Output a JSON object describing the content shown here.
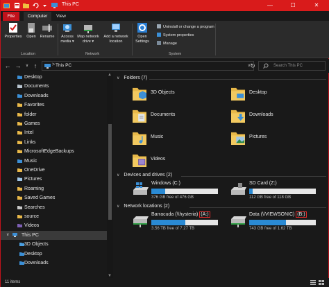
{
  "window": {
    "title": "This PC",
    "minimize": "—",
    "maximize": "☐",
    "close": "✕"
  },
  "tabs": {
    "file": "File",
    "computer": "Computer",
    "view": "View"
  },
  "ribbon": {
    "location": {
      "label": "Location",
      "properties": "Properties",
      "open": "Open",
      "rename": "Rename"
    },
    "network": {
      "label": "Network",
      "access_media_1": "Access",
      "access_media_2": "media ▾",
      "map_drive_1": "Map network",
      "map_drive_2": "drive ▾",
      "add_location_1": "Add a network",
      "add_location_2": "location"
    },
    "system": {
      "label": "System",
      "open_settings_1": "Open",
      "open_settings_2": "Settings",
      "uninstall": "Uninstall or change a program",
      "system_properties": "System properties",
      "manage": "Manage"
    }
  },
  "address": {
    "back": "←",
    "forward": "→",
    "history": "∨",
    "up": "↑",
    "separator": ">",
    "crumb": "This PC",
    "dropdown": "∨",
    "refresh": "↻",
    "search_placeholder": "Search This PC"
  },
  "nav": {
    "items": [
      {
        "label": "Desktop",
        "icon": "folder-blue-icon"
      },
      {
        "label": "Documents",
        "icon": "documents-icon"
      },
      {
        "label": "Downloads",
        "icon": "downloads-icon"
      },
      {
        "label": "Favorites",
        "icon": "star-icon"
      },
      {
        "label": "folder",
        "icon": "folder-icon"
      },
      {
        "label": "Games",
        "icon": "folder-icon"
      },
      {
        "label": "Intel",
        "icon": "folder-icon"
      },
      {
        "label": "Links",
        "icon": "links-icon"
      },
      {
        "label": "MicrosoftEdgeBackups",
        "icon": "folder-icon"
      },
      {
        "label": "Music",
        "icon": "music-icon"
      },
      {
        "label": "OneDrive",
        "icon": "onedrive-icon"
      },
      {
        "label": "Pictures",
        "icon": "pictures-icon"
      },
      {
        "label": "Roaming",
        "icon": "folder-icon"
      },
      {
        "label": "Saved Games",
        "icon": "saved-games-icon"
      },
      {
        "label": "Searches",
        "icon": "search-icon"
      },
      {
        "label": "source",
        "icon": "folder-icon"
      },
      {
        "label": "Videos",
        "icon": "videos-icon"
      }
    ],
    "this_pc": {
      "label": "This PC",
      "chevron": "∨"
    },
    "pc_children": [
      {
        "label": "3D Objects"
      },
      {
        "label": "Desktop"
      },
      {
        "label": "Downloads"
      }
    ],
    "scroll_up": "▲",
    "scroll_down": "▼"
  },
  "content": {
    "folders_header": "Folders (7)",
    "folders": [
      {
        "name": "3D Objects",
        "icon": "3d-objects-icon"
      },
      {
        "name": "Desktop",
        "icon": "desktop-folder-icon"
      },
      {
        "name": "Documents",
        "icon": "documents-folder-icon"
      },
      {
        "name": "Downloads",
        "icon": "downloads-folder-icon"
      },
      {
        "name": "Music",
        "icon": "music-folder-icon"
      },
      {
        "name": "Pictures",
        "icon": "pictures-folder-icon"
      },
      {
        "name": "Videos",
        "icon": "videos-folder-icon"
      }
    ],
    "devices_header": "Devices and drives (2)",
    "drives": [
      {
        "name": "Windows (C:)",
        "free": "376 GB free of 476 GB",
        "used_fraction": 0.21
      },
      {
        "name": "SD Card (Z:)",
        "free": "112 GB free of 118 GB",
        "used_fraction": 0.05
      }
    ],
    "network_header": "Network locations (2)",
    "network": [
      {
        "name_prefix": "Barracuda (\\\\hysteria) ",
        "letter": "(A:)",
        "free": "3.56 TB free of 7.27 TB",
        "used_fraction": 0.51
      },
      {
        "name_prefix": "Data (\\\\VIEWSONIC) ",
        "letter": "(B:)",
        "free": "743 GB free of 1.62 TB",
        "used_fraction": 0.55
      }
    ]
  },
  "status": {
    "count": "11 items"
  },
  "colors": {
    "accent": "#d91b1b",
    "background": "#191919",
    "ribbon": "#2b2b2b",
    "drive_bar": "#2a8ad4",
    "folder": "#e8b849"
  }
}
